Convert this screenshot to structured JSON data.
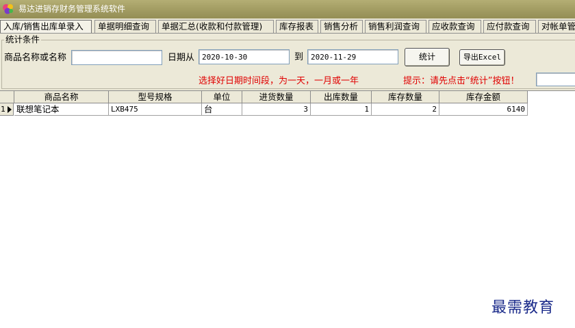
{
  "window": {
    "title": "易达进销存财务管理系统软件",
    "icon": "app-logo-icon"
  },
  "tabs": [
    {
      "label": "入库/销售出库单录入"
    },
    {
      "label": "单据明细查询"
    },
    {
      "label": "单据汇总(收款和付款管理)"
    },
    {
      "label": "库存报表"
    },
    {
      "label": "销售分析"
    },
    {
      "label": "销售利润查询"
    },
    {
      "label": "应收款查询"
    },
    {
      "label": "应付款查询"
    },
    {
      "label": "对帐单管"
    }
  ],
  "filters": {
    "group_label": "统计条件",
    "product_label": "商品名称或名称",
    "product_value": "",
    "date_from_label": "日期从",
    "date_from": "2020-10-30",
    "date_to_label": "到",
    "date_to": "2020-11-29",
    "stats_button": "统计",
    "export_button": "导出Excel",
    "hint_period": "选择好日期时间段，为一天，一月或一年",
    "hint_click": "提示：请先点击“统计”按钮！",
    "extra_value": ""
  },
  "table": {
    "columns": [
      "商品名称",
      "型号规格",
      "单位",
      "进货数量",
      "出库数量",
      "库存数量",
      "库存金额"
    ],
    "rows": [
      {
        "index": "1",
        "cells": [
          "联想笔记本",
          "LXB475",
          "台",
          "3",
          "1",
          "2",
          "6140"
        ]
      }
    ]
  },
  "watermark": "最需教育",
  "colors": {
    "hint_red": "#e00000",
    "titlebar": "#a39d63",
    "watermark": "#1a2a8a"
  }
}
